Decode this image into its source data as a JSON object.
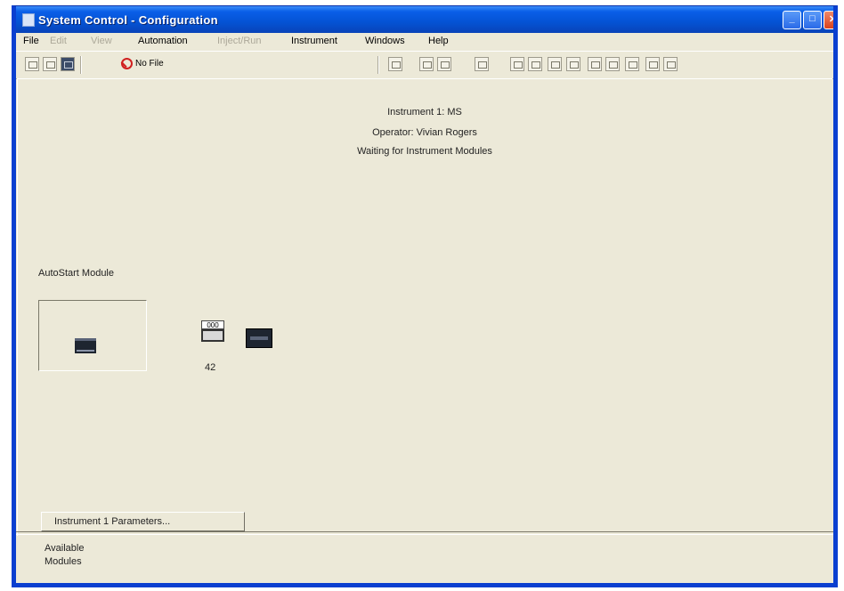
{
  "window": {
    "title": "System Control - Configuration"
  },
  "menu": {
    "items": [
      "File",
      "Edit",
      "View",
      "Automation",
      "Inject/Run",
      "Instrument",
      "Windows",
      "Help"
    ]
  },
  "toolbar": {
    "nofile_label": "No File"
  },
  "status": {
    "line1": "Instrument 1: MS",
    "line2": "Operator: Vivian Rogers",
    "line3": "Waiting for Instrument Modules"
  },
  "modules": {
    "autostart_label": "AutoStart Module",
    "device_caption": "000",
    "device_number": "42"
  },
  "parameters_button": "Instrument 1 Parameters...",
  "available": {
    "line1": "Available",
    "line2": "Modules"
  }
}
